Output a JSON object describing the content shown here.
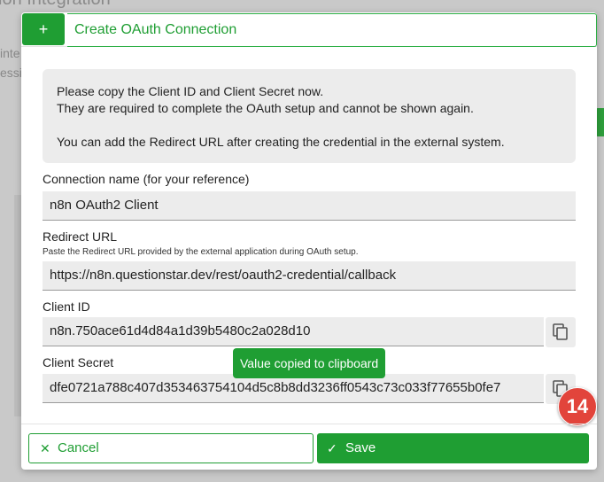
{
  "background": {
    "title": "ion Integration",
    "line1": "inte",
    "line2": "essi"
  },
  "modal": {
    "add_button_label": "+",
    "title": "Create OAuth Connection",
    "notice": {
      "line1": "Please copy the Client ID and Client Secret now.",
      "line2": "They are required to complete the OAuth setup and cannot be shown again.",
      "line3": "You can add the Redirect URL after creating the credential in the external system."
    },
    "connection_name": {
      "label": "Connection name (for your reference)",
      "value": "n8n OAuth2 Client"
    },
    "redirect_url": {
      "label": "Redirect URL",
      "hint": "Paste the Redirect URL provided by the external application during OAuth setup.",
      "value": "https://n8n.questionstar.dev/rest/oauth2-credential/callback"
    },
    "client_id": {
      "label": "Client ID",
      "value": "n8n.750ace61d4d84a1d39b5480c2a028d10",
      "copy_icon": "copy-icon"
    },
    "client_secret": {
      "label": "Client Secret",
      "value": "dfe0721a788c407d353463754104d5c8b8dd3236ff0543c73c033f77655b0fe7",
      "copy_icon": "copy-icon"
    },
    "tooltip": "Value copied to clipboard",
    "badge": "14",
    "cancel_label": "Cancel",
    "save_label": "Save"
  },
  "colors": {
    "accent": "#1f9e33",
    "badge": "#e2443b",
    "field_bg": "#ececec"
  }
}
